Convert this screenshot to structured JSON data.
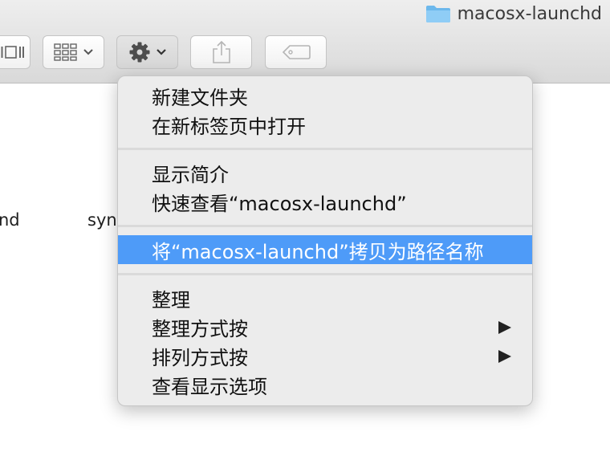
{
  "window": {
    "title": "macosx-launchd"
  },
  "colors": {
    "highlight": "#4e9bf8",
    "menu_bg": "#ececec"
  },
  "icons": {
    "folder": "folder-icon",
    "view": "view-columns-icon",
    "group": "group-grid-icon",
    "action": "gear-icon",
    "share": "share-icon",
    "tag": "tag-icon"
  },
  "files": [
    {
      "name": "nd"
    },
    {
      "name": "syn"
    }
  ],
  "menu": {
    "items": [
      {
        "label": "新建文件夹"
      },
      {
        "label": "在新标签页中打开"
      },
      {
        "label": "显示简介"
      },
      {
        "label": "快速查看“macosx-launchd”"
      },
      {
        "label": "将“macosx-launchd”拷贝为路径名称",
        "highlighted": true
      },
      {
        "label": "整理"
      },
      {
        "label": "整理方式按",
        "submenu": true
      },
      {
        "label": "排列方式按",
        "submenu": true
      },
      {
        "label": "查看显示选项"
      }
    ]
  }
}
